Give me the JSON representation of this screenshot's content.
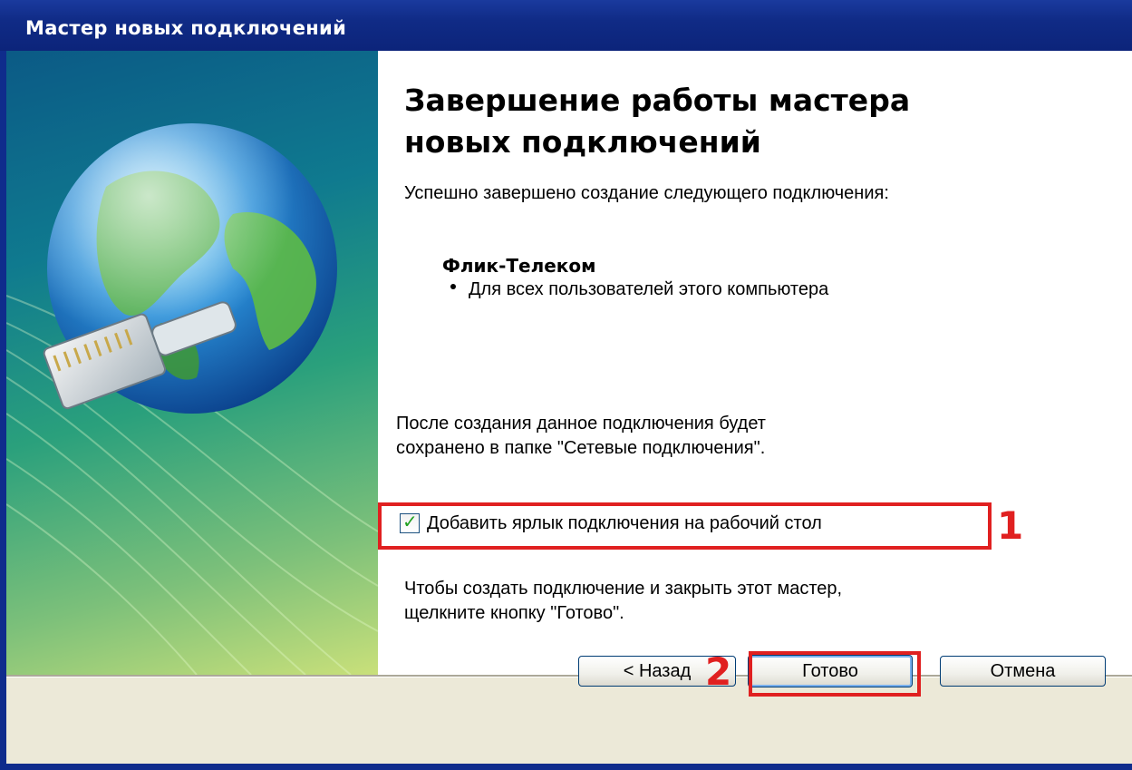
{
  "window": {
    "title": "Мастер новых подключений"
  },
  "content": {
    "heading_line1": "Завершение работы мастера",
    "heading_line2": "новых подключений",
    "success_text": "Успешно завершено создание следующего подключения:",
    "connection_name": "Флик-Телеком",
    "connection_scope": "Для всех пользователей этого компьютера",
    "saved_line1": "После создания данное подключения будет",
    "saved_line2": "сохранено в папке \"Сетевые подключения\".",
    "shortcut_checkbox_label": "Добавить ярлык подключения на рабочий стол",
    "shortcut_checked": true,
    "finish_hint_line1": "Чтобы создать подключение и закрыть этот мастер,",
    "finish_hint_line2": "щелкните кнопку \"Готово\"."
  },
  "annotations": {
    "marker_1": "1",
    "marker_2": "2",
    "highlight_color": "#e02020"
  },
  "buttons": {
    "back_label": "< Назад",
    "finish_label": "Готово",
    "cancel_label": "Отмена"
  },
  "icons": {
    "wizard_image": "globe-network-cable-icon",
    "checkbox": "checkbox-checked-icon"
  },
  "colors": {
    "titlebar": "#0c247a",
    "dialog_bg": "#ece9d8",
    "content_bg": "#ffffff"
  }
}
